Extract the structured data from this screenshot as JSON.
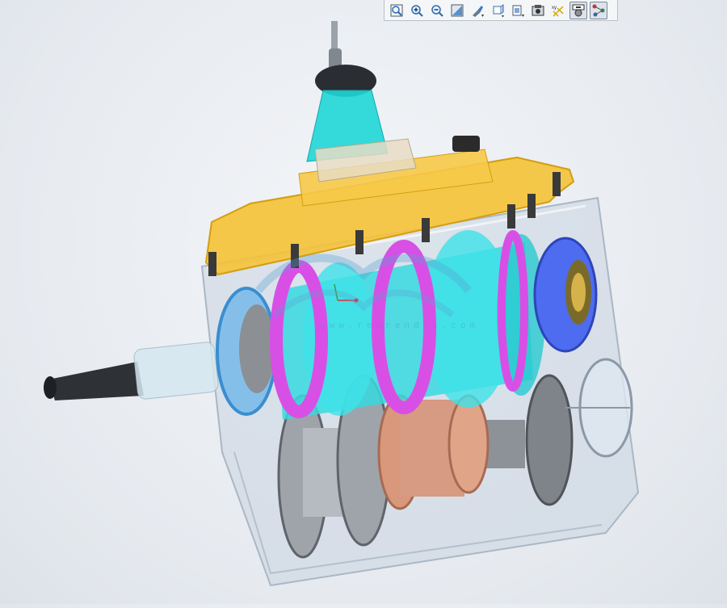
{
  "toolbar": {
    "buttons": [
      {
        "icon": "zoom-fit-icon",
        "active": false
      },
      {
        "icon": "zoom-in-icon",
        "active": false
      },
      {
        "icon": "zoom-out-icon",
        "active": false
      },
      {
        "icon": "view-refit-icon",
        "active": false
      },
      {
        "icon": "repaint-icon",
        "active": false
      },
      {
        "icon": "display-style-icon",
        "active": false
      },
      {
        "icon": "saved-views-icon",
        "active": false
      },
      {
        "icon": "section-view-icon",
        "active": false
      },
      {
        "icon": "datum-display-icon",
        "active": false
      },
      {
        "icon": "appearance-icon",
        "active": true
      },
      {
        "icon": "annotation-display-icon",
        "active": true
      }
    ]
  },
  "model": {
    "watermark_text": "www.renrendoc.com",
    "colors": {
      "housing": "#c8d4e0",
      "top_cover": "#f4c236",
      "shifter_boot": "#1fd6d6",
      "synchro_gears": "#36d9df",
      "shift_forks": "#d84fe6",
      "bearing": "#4d6cf0",
      "counter_gears": "#9ea4aa",
      "reverse_gear": "#d9987c"
    }
  }
}
